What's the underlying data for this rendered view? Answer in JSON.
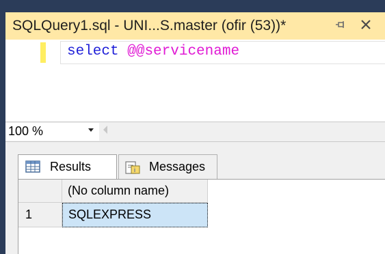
{
  "document_tab": {
    "title": "SQLQuery1.sql - UNI...S.master (ofir (53))*",
    "pin_icon": "pin-icon",
    "close_icon": "close-icon"
  },
  "editor": {
    "code_keyword": "select",
    "code_space": " ",
    "code_sysvar": "@@servicename"
  },
  "zoom": {
    "value": "100 %"
  },
  "results": {
    "tabs": [
      {
        "label": "Results",
        "icon": "grid-icon"
      },
      {
        "label": "Messages",
        "icon": "messages-icon"
      }
    ],
    "column_header": "(No column name)",
    "rows": [
      {
        "row_number": "1",
        "value": "SQLEXPRESS"
      }
    ]
  },
  "colors": {
    "tab_active": "#ffe8a6",
    "keyword": "#1f1fd8",
    "system_variable": "#e01ad4",
    "selected_cell": "#cce4f7",
    "window_frame": "#2b3c59"
  }
}
